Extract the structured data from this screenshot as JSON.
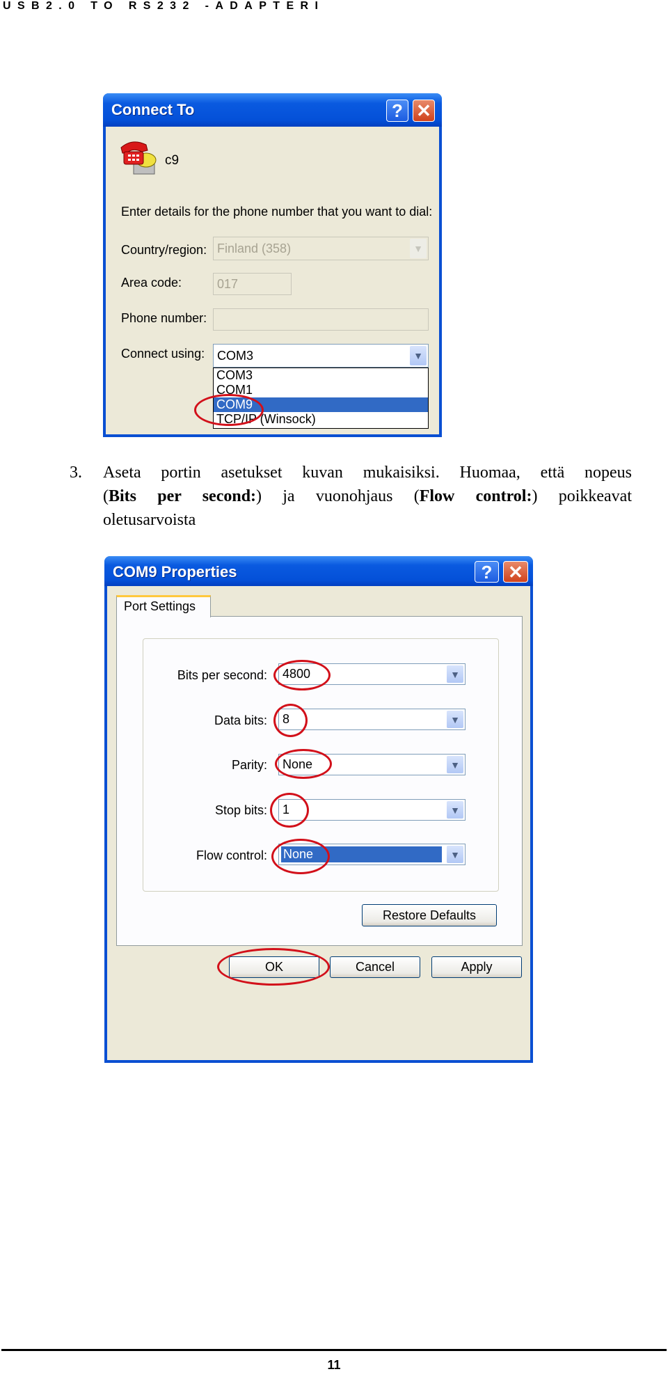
{
  "header": {
    "title": "USB2.0 TO RS232 -ADAPTERI"
  },
  "connect_dialog": {
    "title": "Connect To",
    "connection_name": "c9",
    "icon": "phone-icon",
    "instruction": "Enter details for the phone number that you want to dial:",
    "country_label": "Country/region:",
    "country_value": "Finland (358)",
    "area_label": "Area code:",
    "area_value": "017",
    "phone_label": "Phone number:",
    "phone_value": "",
    "connect_label": "Connect using:",
    "connect_value": "COM3",
    "options": [
      "COM3",
      "COM1",
      "COM9",
      "TCP/IP (Winsock)"
    ],
    "selected_option": "COM9"
  },
  "step": {
    "number": "3.",
    "line1": "Aseta portin asetukset kuvan mukaisiksi. Huomaa, että nopeus",
    "line2_a": "(",
    "line2_b": "Bits per second:",
    "line2_c": ") ja vuonohjaus (",
    "line2_d": "Flow control:",
    "line2_e": ") poikkeavat",
    "line3": "oletusarvoista"
  },
  "properties_dialog": {
    "title": "COM9 Properties",
    "tab": "Port Settings",
    "fields": [
      {
        "label": "Bits per second:",
        "value": "4800"
      },
      {
        "label": "Data bits:",
        "value": "8"
      },
      {
        "label": "Parity:",
        "value": "None"
      },
      {
        "label": "Stop bits:",
        "value": "1"
      },
      {
        "label": "Flow control:",
        "value": "None"
      }
    ],
    "restore_defaults": "Restore Defaults",
    "ok": "OK",
    "cancel": "Cancel",
    "apply": "Apply"
  },
  "colors": {
    "titlebar": "#0450D8",
    "selection": "#316AC5",
    "highlight_circle": "#D2101A"
  },
  "footer": {
    "page_number": "11"
  }
}
